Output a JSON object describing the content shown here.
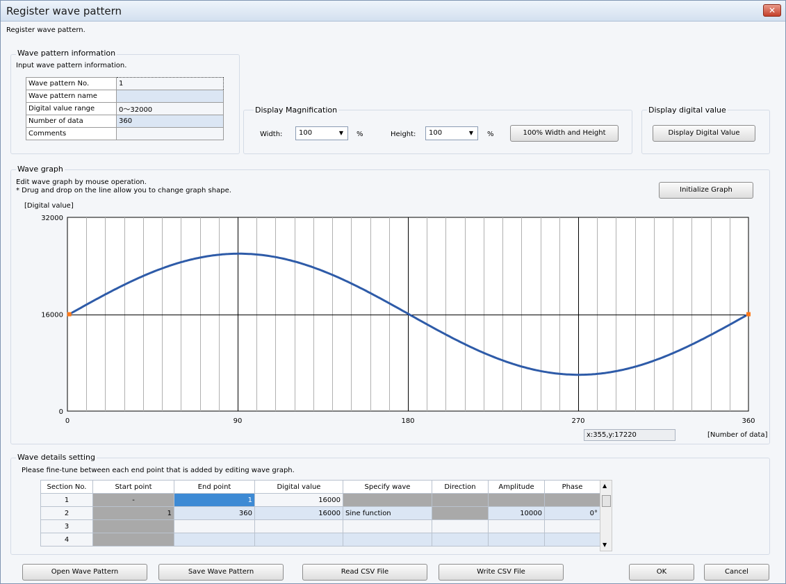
{
  "window": {
    "title": "Register wave pattern",
    "close_glyph": "✕"
  },
  "intro": "Register wave pattern.",
  "info": {
    "group_title": "Wave pattern information",
    "hint": "Input wave pattern information.",
    "rows": [
      {
        "label": "Wave pattern No.",
        "value": "1"
      },
      {
        "label": "Wave pattern name",
        "value": ""
      },
      {
        "label": "Digital value range",
        "value": "0～32000"
      },
      {
        "label": "Number of data",
        "value": "360"
      },
      {
        "label": "Comments",
        "value": ""
      }
    ]
  },
  "magnification": {
    "group_title": "Display Magnification",
    "width_label": "Width:",
    "width_value": "100",
    "width_unit": "%",
    "height_label": "Height:",
    "height_value": "100",
    "height_unit": "%",
    "reset_button": "100% Width and Height"
  },
  "digital": {
    "group_title": "Display digital value",
    "button": "Display Digital Value"
  },
  "graph": {
    "group_title": "Wave graph",
    "hint1": "Edit wave graph by mouse operation.",
    "hint2": "* Drug and drop on the line allow you to change graph shape.",
    "init_button": "Initialize Graph",
    "y_label": "[Digital value]",
    "x_label": "[Number of data]",
    "coord_readout": "x:355,y:17220",
    "colors": {
      "curve": "#2e5ba8",
      "handle": "#ff7a1a"
    }
  },
  "chart_data": {
    "type": "line",
    "xlabel": "[Number of data]",
    "ylabel": "[Digital value]",
    "xlim": [
      0,
      360
    ],
    "ylim": [
      0,
      32000
    ],
    "x_ticks": [
      "0",
      "90",
      "180",
      "270",
      "360"
    ],
    "y_ticks": [
      "0",
      "16000",
      "32000"
    ],
    "grid": true,
    "series": [
      {
        "function": "sine",
        "offset": 16000,
        "amplitude": 10000,
        "phase_deg": 0,
        "x_range": [
          1,
          360
        ],
        "end_points": [
          {
            "x": 1,
            "y": 16000
          },
          {
            "x": 360,
            "y": 16000
          }
        ]
      }
    ]
  },
  "details": {
    "group_title": "Wave details setting",
    "hint": "Please fine-tune between each end point that is added by editing wave graph.",
    "columns": [
      "Section No.",
      "Start point",
      "End point",
      "Digital value",
      "Specify wave",
      "Direction",
      "Amplitude",
      "Phase"
    ],
    "rows": [
      [
        "1",
        "-",
        "1",
        "16000",
        "",
        "",
        "",
        ""
      ],
      [
        "2",
        "1",
        "360",
        "16000",
        "Sine function",
        "",
        "10000",
        "0°"
      ],
      [
        "3",
        "",
        "",
        "",
        "",
        "",
        "",
        ""
      ],
      [
        "4",
        "",
        "",
        "",
        "",
        "",
        "",
        ""
      ]
    ]
  },
  "footer": {
    "open": "Open Wave Pattern",
    "save": "Save Wave Pattern",
    "read_csv": "Read CSV File",
    "write_csv": "Write CSV File",
    "ok": "OK",
    "cancel": "Cancel"
  }
}
